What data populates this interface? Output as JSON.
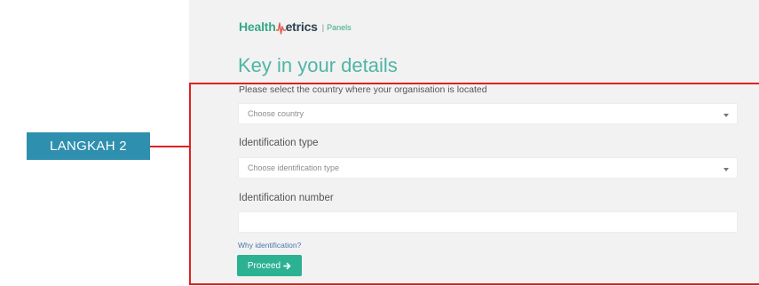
{
  "header": {
    "brand_part1": "Health",
    "brand_part2": "etrics",
    "separator": "|",
    "brand_sub": "Panels"
  },
  "main": {
    "title": "Key in your details",
    "country": {
      "label": "Please select the country where your organisation is located",
      "placeholder": "Choose country"
    },
    "id_type": {
      "label": "Identification type",
      "placeholder": "Choose identification type"
    },
    "id_number": {
      "label": "Identification number",
      "value": ""
    },
    "help_link": "Why identification?",
    "proceed_label": "Proceed"
  },
  "annotation": {
    "step_label": "LANGKAH 2",
    "step_color": "#2f8fae",
    "highlight_color": "#e02020"
  },
  "colors": {
    "brand_green": "#37a987",
    "button": "#2cb193",
    "title": "#4fb5a5",
    "link": "#4a78b0"
  },
  "icons": {
    "brand_mark": "heartbeat-m-icon",
    "dropdown": "caret-down-icon",
    "proceed": "arrow-right-icon"
  }
}
